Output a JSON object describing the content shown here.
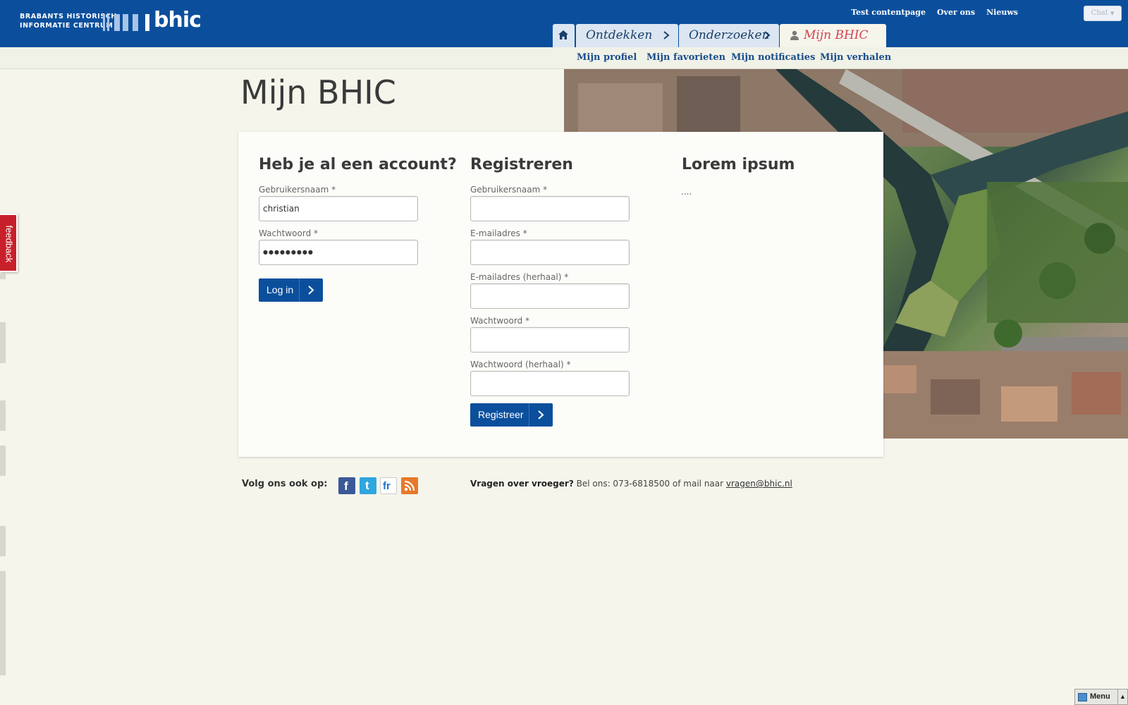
{
  "header": {
    "logo_line1": "BRABANTS HISTORISCH",
    "logo_line2": "INFORMATIE CENTRUM",
    "logo_word": "bhic",
    "top_links": [
      "Test contentpage",
      "Over ons",
      "Nieuws"
    ],
    "chat_label": "Chat",
    "tabs": [
      {
        "label": "Ontdekken"
      },
      {
        "label": "Onderzoeken"
      },
      {
        "label": "Mijn BHIC"
      }
    ],
    "subnav": [
      "Mijn profiel",
      "Mijn favorieten",
      "Mijn notificaties",
      "Mijn verhalen"
    ]
  },
  "page": {
    "title": "Mijn BHIC"
  },
  "login": {
    "title": "Heb je al een account?",
    "username_label": "Gebruikersnaam *",
    "username_value": "christian",
    "password_label": "Wachtwoord *",
    "password_value": "●●●●●●●●●",
    "submit_label": "Log in"
  },
  "register": {
    "title": "Registreren",
    "fields": [
      {
        "label": "Gebruikersnaam *"
      },
      {
        "label": "E-mailadres *"
      },
      {
        "label": "E-mailadres (herhaal) *"
      },
      {
        "label": "Wachtwoord *"
      },
      {
        "label": "Wachtwoord (herhaal) *"
      }
    ],
    "submit_label": "Registreer"
  },
  "lorem": {
    "title": "Lorem ipsum",
    "body": "...."
  },
  "footer": {
    "follow_label": "Volg ons ook op:",
    "social": [
      {
        "name": "facebook-icon",
        "glyph": "f",
        "color": "#3b5998"
      },
      {
        "name": "twitter-icon",
        "glyph": "t",
        "color": "#2fa6de"
      },
      {
        "name": "flickr-icon",
        "glyph": "fr",
        "color": "#ffffff"
      },
      {
        "name": "rss-icon",
        "glyph": "rss",
        "color": "#e8782a"
      }
    ],
    "contact_bold": "Vragen over vroeger?",
    "contact_text": " Bel ons: 073-6818500 of mail naar ",
    "contact_email": "vragen@bhic.nl"
  },
  "widgets": {
    "feedback_label": "feedback",
    "menu_label": "Menu"
  },
  "colors": {
    "brand_blue": "#0b4f9c",
    "accent_red": "#d3424e",
    "background": "#f6f5ec"
  }
}
